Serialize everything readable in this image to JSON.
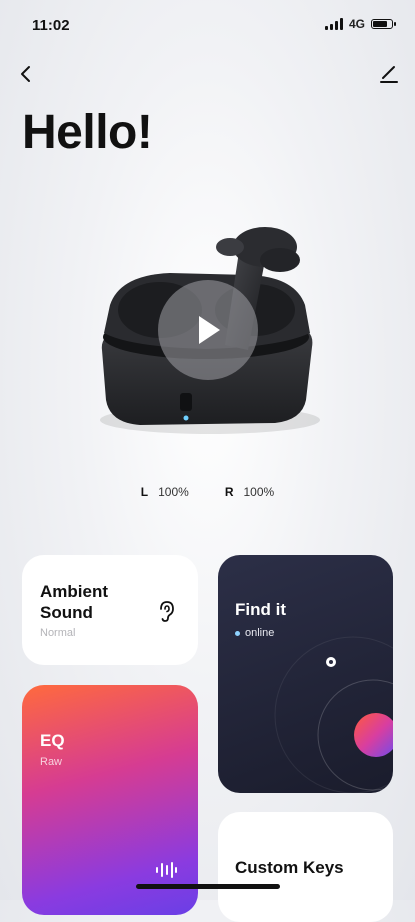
{
  "status_bar": {
    "time": "11:02",
    "network": "4G"
  },
  "header": {
    "greeting": "Hello!"
  },
  "battery": {
    "left_label": "L",
    "left_value": "100%",
    "right_label": "R",
    "right_value": "100%"
  },
  "cards": {
    "ambient": {
      "title": "Ambient Sound",
      "subtitle": "Normal",
      "icon": "ear-icon"
    },
    "find": {
      "title": "Find it",
      "status": "online"
    },
    "eq": {
      "title": "EQ",
      "subtitle": "Raw",
      "icon": "waveform-icon"
    },
    "keys": {
      "title": "Custom Keys"
    }
  },
  "colors": {
    "find_card": "#1f2135",
    "eq_gradient_start": "#ff6a3d",
    "eq_gradient_end": "#6a3fe6",
    "online_dot": "#8fd3ff"
  }
}
